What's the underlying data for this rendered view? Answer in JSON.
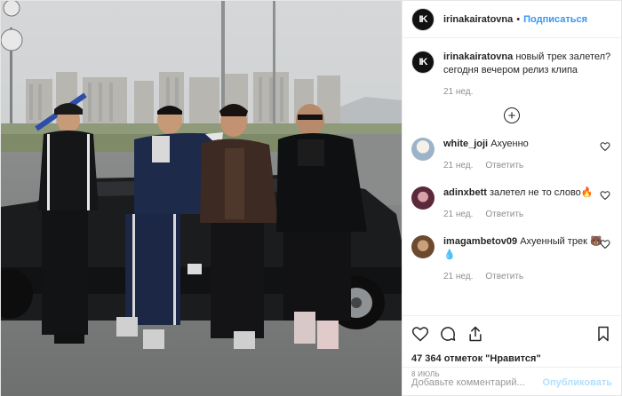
{
  "post": {
    "username": "irinakairatovna",
    "follow_label": "Подписаться",
    "dot": "•",
    "avatar_text": "IK"
  },
  "caption": {
    "username": "irinakairatovna",
    "text": "новый трек залетел? сегодня вечером релиз клипа",
    "time": "21 нед."
  },
  "comments": [
    {
      "username": "white_joji",
      "text": "Ахуенно",
      "time": "21 нед.",
      "reply": "Ответить"
    },
    {
      "username": "adinxbett",
      "text": "залетел не то слово🔥",
      "time": "21 нед.",
      "reply": "Ответить"
    },
    {
      "username": "imagambetov09",
      "text": "Ахуенный трек 🐻💧",
      "time": "21 нед.",
      "reply": "Ответить"
    }
  ],
  "likes": "47 364 отметок \"Нравится\"",
  "date": "8 ИЮЛЬ",
  "add_comment": {
    "placeholder": "Добавьте комментарий...",
    "publish": "Опубликовать"
  },
  "colors": {
    "link": "#3897f0",
    "muted": "#8e8e8e",
    "publish_disabled": "#b2dffc"
  },
  "icons": [
    "heart-icon",
    "comment-icon",
    "share-icon",
    "bookmark-icon",
    "plus-circle-icon"
  ]
}
